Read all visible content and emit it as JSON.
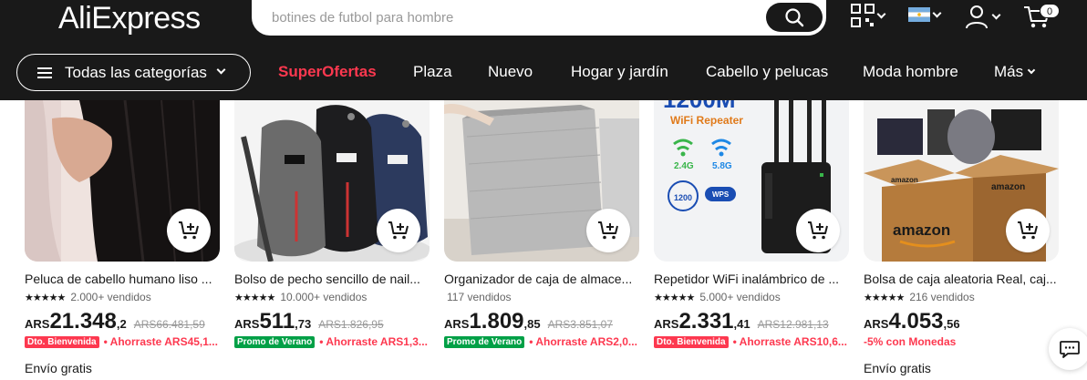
{
  "header": {
    "logo": "AliExpress",
    "search_placeholder": "botines de futbol para hombre",
    "cart_count": "0",
    "icons": [
      "qr-code-icon",
      "flag-argentina-icon",
      "user-icon",
      "cart-icon",
      "search-icon"
    ]
  },
  "nav": {
    "categories_label": "Todas las categorías",
    "items": [
      "SuperOfertas",
      "Plaza",
      "Nuevo",
      "Hogar y jardín",
      "Cabello y pelucas",
      "Moda hombre",
      "Más"
    ]
  },
  "colors": {
    "header_bg": "#191919",
    "accent_red": "#fd384f",
    "promo_green": "#00a046",
    "dto_red": "#fd384f"
  },
  "products": [
    {
      "title": "Peluca de cabello humano liso ...",
      "rating_stars": 4.5,
      "sold": "2.000+ vendidos",
      "currency": "ARS",
      "price_int": "21.348",
      "price_dec": ",2",
      "orig_price": "ARS66.481,59",
      "tag": "Dto. Bienvenida",
      "tag_color": "#fd384f",
      "saving": "• Ahorraste ARS45,1...",
      "shipping": "Envío gratis"
    },
    {
      "title": "Bolso de pecho sencillo de nail...",
      "rating_stars": 4.5,
      "sold": "10.000+ vendidos",
      "currency": "ARS",
      "price_int": "511",
      "price_dec": ",73",
      "orig_price": "ARS1.826,95",
      "tag": "Promo de Verano",
      "tag_color": "#00a046",
      "saving": "• Ahorraste ARS1,3...",
      "shipping": ""
    },
    {
      "title": "Organizador de caja de almace...",
      "rating_stars": 0,
      "sold": "117 vendidos",
      "currency": "ARS",
      "price_int": "1.809",
      "price_dec": ",85",
      "orig_price": "ARS3.851,07",
      "tag": "Promo de Verano",
      "tag_color": "#00a046",
      "saving": "• Ahorraste ARS2,0...",
      "shipping": ""
    },
    {
      "title": "Repetidor WiFi inalámbrico de ...",
      "rating_stars": 4.5,
      "sold": "5.000+ vendidos",
      "currency": "ARS",
      "price_int": "2.331",
      "price_dec": ",41",
      "orig_price": "ARS12.981,13",
      "tag": "Dto. Bienvenida",
      "tag_color": "#fd384f",
      "saving": "• Ahorraste ARS10,6...",
      "shipping": "",
      "image_text": [
        "1200M",
        "WiFi Repeater",
        "2.4G",
        "5.8G",
        "1200",
        "WPS"
      ]
    },
    {
      "title": "Bolsa de caja aleatoria Real, caj...",
      "rating_stars": 5,
      "sold": "216 vendidos",
      "currency": "ARS",
      "price_int": "4.053",
      "price_dec": ",56",
      "orig_price": "",
      "tag": "",
      "tag_color": "",
      "saving": "-5% con Monedas",
      "shipping": "Envío gratis",
      "image_text": [
        "amazon",
        "amazon",
        "amazon"
      ]
    }
  ]
}
